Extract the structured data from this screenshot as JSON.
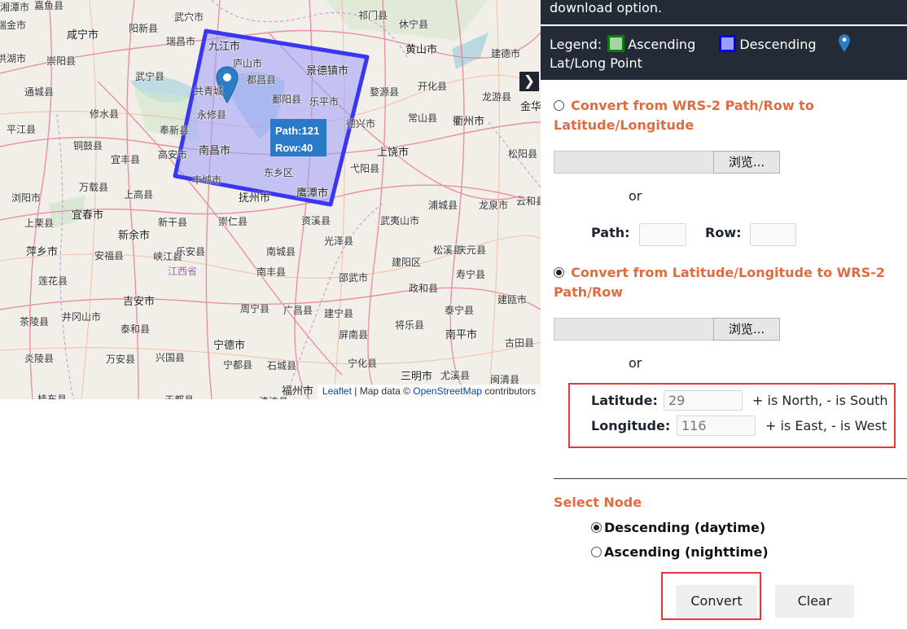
{
  "map": {
    "footprint": {
      "path": 121,
      "row": 40,
      "path_label": "Path:121",
      "row_label": "Row:40",
      "color": "#3b36f2",
      "fill": "#9d9dfb"
    },
    "marker": {
      "lat": 29,
      "lon": 116,
      "color": "#2b7dc4"
    },
    "toggle_icon": "chevron-right-icon",
    "toggle_glyph": "❯",
    "attribution": {
      "leaflet": "Leaflet",
      "sep": " | Map data © ",
      "osm": "OpenStreetMap",
      "suffix": " contributors"
    },
    "labels": [
      {
        "t": "嘉鱼县",
        "c": "sm"
      },
      {
        "t": "咸宁市",
        "c": "big"
      },
      {
        "t": "崇阳县",
        "c": "sm"
      },
      {
        "t": "通城县",
        "c": "sm"
      },
      {
        "t": "平江县",
        "c": "sm"
      },
      {
        "t": "铜鼓县",
        "c": "sm"
      },
      {
        "t": "修水县",
        "c": "sm"
      },
      {
        "t": "武宁县",
        "c": "sm"
      },
      {
        "t": "阳新县",
        "c": "sm"
      },
      {
        "t": "武穴市",
        "c": "sm"
      },
      {
        "t": "瑞昌市",
        "c": "sm"
      },
      {
        "t": "奉新县",
        "c": "sm"
      },
      {
        "t": "宜丰县",
        "c": "sm"
      },
      {
        "t": "高安市",
        "c": "sm"
      },
      {
        "t": "九江市",
        "c": "big"
      },
      {
        "t": "庐山市",
        "c": "sm"
      },
      {
        "t": "都昌县",
        "c": "sm"
      },
      {
        "t": "共青城",
        "c": "sm"
      },
      {
        "t": "永修县",
        "c": "sm"
      },
      {
        "t": "鄱阳县",
        "c": "sm"
      },
      {
        "t": "乐平市",
        "c": "sm"
      },
      {
        "t": "景德镇市",
        "c": "big"
      },
      {
        "t": "南昌市",
        "c": "big"
      },
      {
        "t": "东乡区",
        "c": "sm"
      },
      {
        "t": "丰城市",
        "c": "sm"
      },
      {
        "t": "鹰潭市",
        "c": "big"
      },
      {
        "t": "抚州市",
        "c": "big"
      },
      {
        "t": "祁门县",
        "c": "sm"
      },
      {
        "t": "休宁县",
        "c": "sm"
      },
      {
        "t": "黄山市",
        "c": "big"
      },
      {
        "t": "建德市",
        "c": "sm"
      },
      {
        "t": "婺源县",
        "c": "sm"
      },
      {
        "t": "开化县",
        "c": "sm"
      },
      {
        "t": "龙游县",
        "c": "sm"
      },
      {
        "t": "金华",
        "c": "big"
      },
      {
        "t": "常山县",
        "c": "sm"
      },
      {
        "t": "衢州市",
        "c": "big"
      },
      {
        "t": "德兴市",
        "c": "sm"
      },
      {
        "t": "上饶市",
        "c": "big"
      },
      {
        "t": "弋阳县",
        "c": "sm"
      },
      {
        "t": "松阳县",
        "c": "sm"
      },
      {
        "t": "浦城县",
        "c": "sm"
      },
      {
        "t": "龙泉市",
        "c": "sm"
      },
      {
        "t": "云和县",
        "c": "sm"
      },
      {
        "t": "浏阳市",
        "c": "sm"
      },
      {
        "t": "万载县",
        "c": "sm"
      },
      {
        "t": "上高县",
        "c": "sm"
      },
      {
        "t": "宜春市",
        "c": "big"
      },
      {
        "t": "上栗县",
        "c": "sm"
      },
      {
        "t": "新余市",
        "c": "big"
      },
      {
        "t": "新干县",
        "c": "sm"
      },
      {
        "t": "萍乡市",
        "c": "big"
      },
      {
        "t": "安福县",
        "c": "sm"
      },
      {
        "t": "峡江县",
        "c": "sm"
      },
      {
        "t": "江西省",
        "c": "prov"
      },
      {
        "t": "莲花县",
        "c": "sm"
      },
      {
        "t": "吉安市",
        "c": "big"
      },
      {
        "t": "井冈山市",
        "c": "sm"
      },
      {
        "t": "茶陵县",
        "c": "sm"
      },
      {
        "t": "泰和县",
        "c": "sm"
      },
      {
        "t": "炎陵县",
        "c": "sm"
      },
      {
        "t": "万安县",
        "c": "sm"
      },
      {
        "t": "兴国县",
        "c": "sm"
      },
      {
        "t": "于都县",
        "c": "sm"
      },
      {
        "t": "桂东县",
        "c": "sm"
      },
      {
        "t": "崇仁县",
        "c": "sm"
      },
      {
        "t": "乐安县",
        "c": "sm"
      },
      {
        "t": "南城县",
        "c": "sm"
      },
      {
        "t": "南丰县",
        "c": "sm"
      },
      {
        "t": "资溪县",
        "c": "sm"
      },
      {
        "t": "光泽县",
        "c": "sm"
      },
      {
        "t": "武夷山市",
        "c": "sm"
      },
      {
        "t": "邵武市",
        "c": "sm"
      },
      {
        "t": "建阳区",
        "c": "sm"
      },
      {
        "t": "松溪县",
        "c": "sm"
      },
      {
        "t": "庆元县",
        "c": "sm"
      },
      {
        "t": "寿宁县",
        "c": "sm"
      },
      {
        "t": "政和县",
        "c": "sm"
      },
      {
        "t": "建瓯市",
        "c": "sm"
      },
      {
        "t": "周宁县",
        "c": "sm"
      },
      {
        "t": "广昌县",
        "c": "sm"
      },
      {
        "t": "建宁县",
        "c": "sm"
      },
      {
        "t": "泰宁县",
        "c": "sm"
      },
      {
        "t": "屏南县",
        "c": "sm"
      },
      {
        "t": "将乐县",
        "c": "sm"
      },
      {
        "t": "南平市",
        "c": "big"
      },
      {
        "t": "古田县",
        "c": "sm"
      },
      {
        "t": "宁德市",
        "c": "big"
      },
      {
        "t": "宁都县",
        "c": "sm"
      },
      {
        "t": "石城县",
        "c": "sm"
      },
      {
        "t": "宁化县",
        "c": "sm"
      },
      {
        "t": "三明市",
        "c": "big"
      },
      {
        "t": "尤溪县",
        "c": "sm"
      },
      {
        "t": "闽清县",
        "c": "sm"
      },
      {
        "t": "福州市",
        "c": "big"
      },
      {
        "t": "清流县",
        "c": "sm"
      },
      {
        "t": "瑞金市",
        "c": "sm"
      },
      {
        "t": "洪湖市",
        "c": "sm"
      },
      {
        "t": "湘潭市",
        "c": "sm"
      }
    ]
  },
  "panel": {
    "header_text": "download option.",
    "legend": {
      "label": "Legend:",
      "ascending": "Ascending",
      "descending": "Descending",
      "point": "Lat/Long Point",
      "colors": {
        "ascending_border": "#0a7a0a",
        "ascending_fill": "#a6d3a6",
        "descending_border": "#0000ee",
        "descending_fill": "#9d9dfb",
        "pin": "#2b7dc4"
      }
    },
    "option1": {
      "title": "Convert from WRS-2 Path/Row to Latitude/Longitude",
      "selected": false
    },
    "file_button_label": "浏览...",
    "or_label": "or",
    "path_label": "Path:",
    "row_label": "Row:",
    "path_value": "",
    "row_value": "",
    "option2": {
      "title": "Convert from Latitude/Longitude to WRS-2 Path/Row",
      "selected": true
    },
    "latitude_label": "Latitude:",
    "latitude_placeholder": "29",
    "latitude_hint": "+ is North, - is South",
    "longitude_label": "Longitude:",
    "longitude_placeholder": "116",
    "longitude_hint": "+ is East, - is West",
    "select_node_title": "Select Node",
    "nodes": [
      {
        "label": "Descending (daytime)",
        "selected": true
      },
      {
        "label": "Ascending (nighttime)",
        "selected": false
      }
    ],
    "convert_label": "Convert",
    "clear_label": "Clear",
    "accent_color": "#e06b40",
    "highlight_color": "#e8353a"
  }
}
